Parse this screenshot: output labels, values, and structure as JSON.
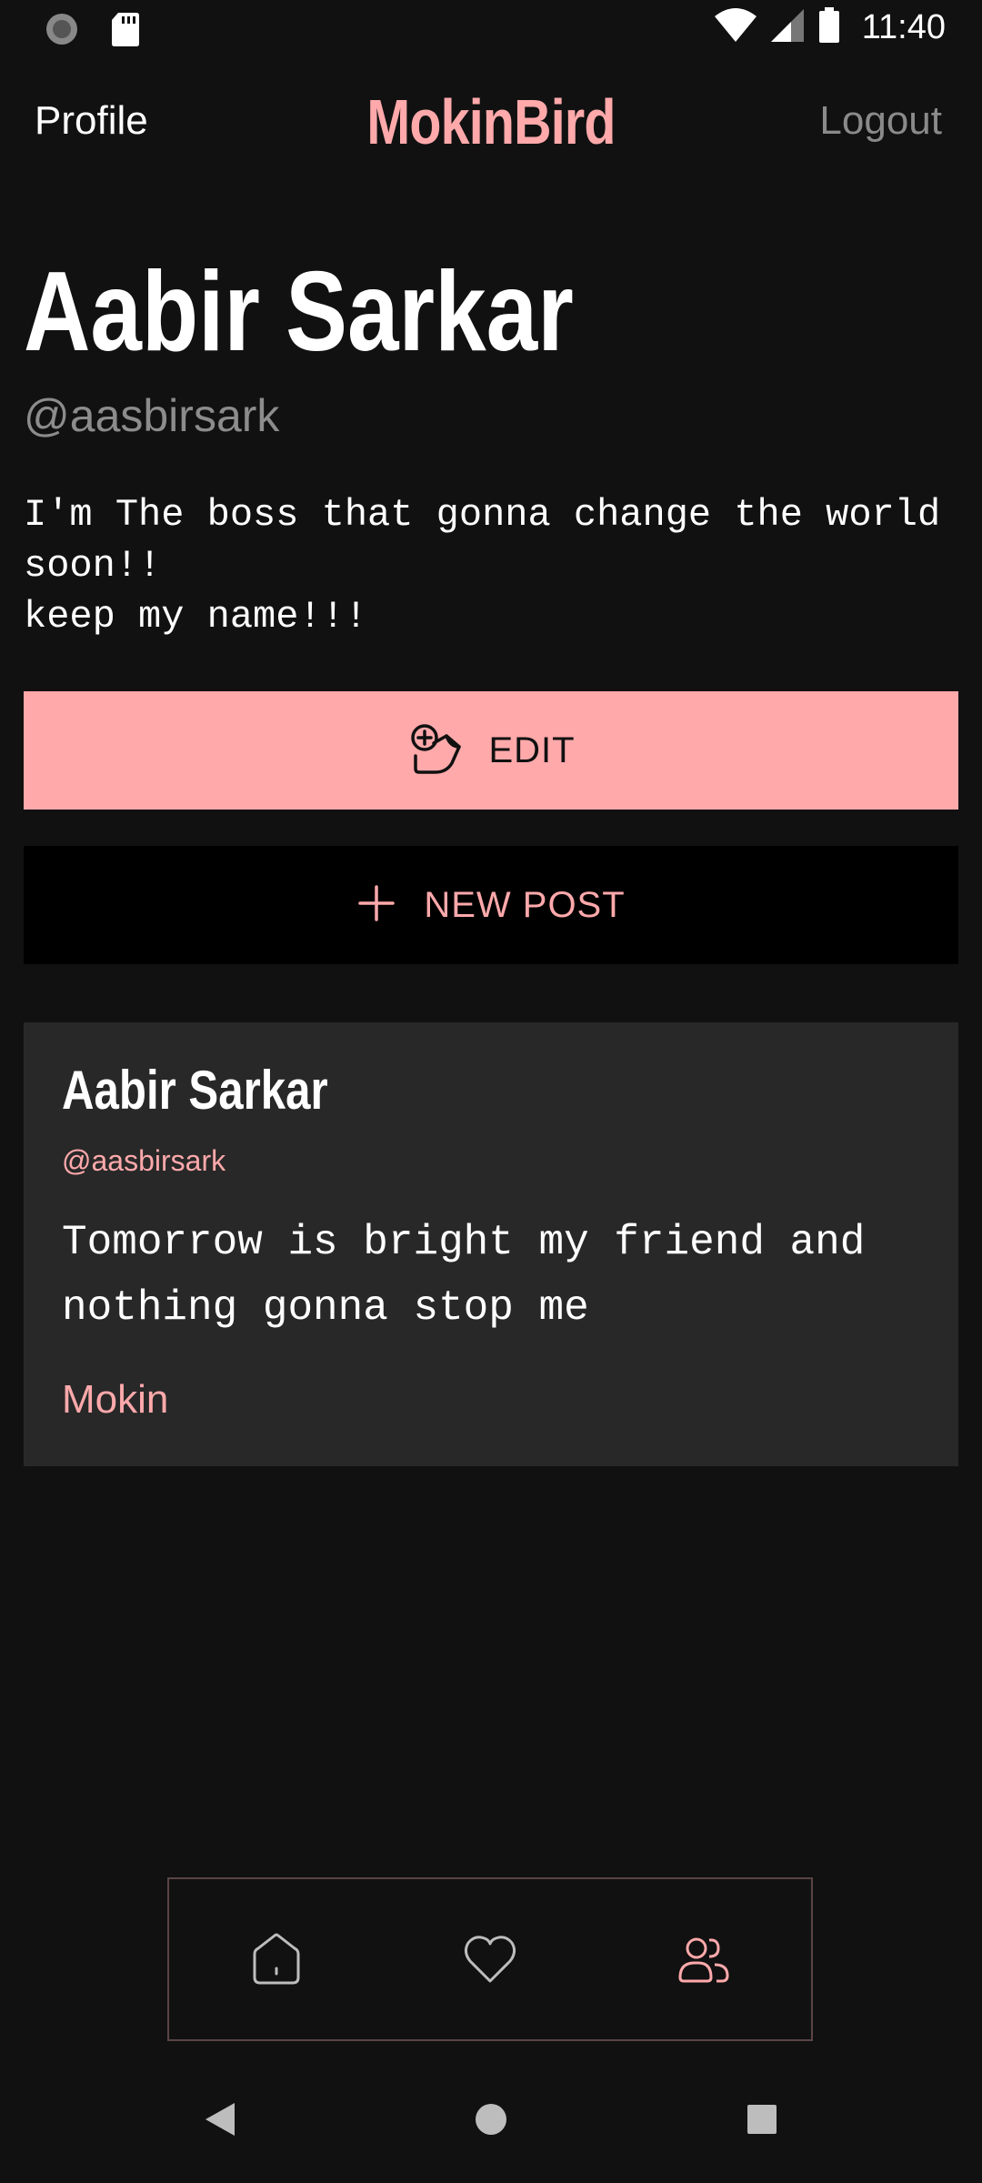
{
  "status_bar": {
    "time": "11:40"
  },
  "app_bar": {
    "left_label": "Profile",
    "brand": "MokinBird",
    "right_label": "Logout"
  },
  "profile": {
    "name": "Aabir Sarkar",
    "handle": "@aasbirsark",
    "bio": "I'm The boss that gonna change the world\nsoon!!\nkeep my name!!!"
  },
  "actions": {
    "edit_label": "EDIT",
    "new_post_label": "NEW POST"
  },
  "posts": [
    {
      "author": "Aabir Sarkar",
      "handle": "@aasbirsark",
      "text": "Tomorrow is bright my friend and nothing gonna stop me",
      "action_label": "Mokin"
    }
  ],
  "bottom_nav": {
    "items": [
      {
        "icon": "home-icon",
        "active": false
      },
      {
        "icon": "heart-icon",
        "active": false
      },
      {
        "icon": "users-icon",
        "active": true
      }
    ]
  },
  "colors": {
    "accent": "#ffa9ab",
    "background": "#111111",
    "card": "#282828",
    "muted": "#8c8c8c"
  }
}
